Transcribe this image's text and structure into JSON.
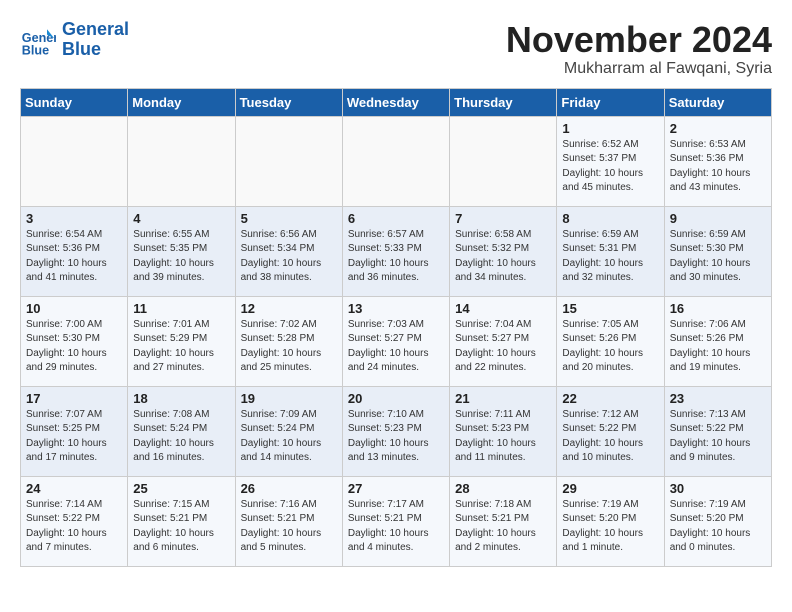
{
  "header": {
    "logo_line1": "General",
    "logo_line2": "Blue",
    "title": "November 2024",
    "subtitle": "Mukharram al Fawqani, Syria"
  },
  "weekdays": [
    "Sunday",
    "Monday",
    "Tuesday",
    "Wednesday",
    "Thursday",
    "Friday",
    "Saturday"
  ],
  "weeks": [
    [
      {
        "day": "",
        "info": ""
      },
      {
        "day": "",
        "info": ""
      },
      {
        "day": "",
        "info": ""
      },
      {
        "day": "",
        "info": ""
      },
      {
        "day": "",
        "info": ""
      },
      {
        "day": "1",
        "info": "Sunrise: 6:52 AM\nSunset: 5:37 PM\nDaylight: 10 hours\nand 45 minutes."
      },
      {
        "day": "2",
        "info": "Sunrise: 6:53 AM\nSunset: 5:36 PM\nDaylight: 10 hours\nand 43 minutes."
      }
    ],
    [
      {
        "day": "3",
        "info": "Sunrise: 6:54 AM\nSunset: 5:36 PM\nDaylight: 10 hours\nand 41 minutes."
      },
      {
        "day": "4",
        "info": "Sunrise: 6:55 AM\nSunset: 5:35 PM\nDaylight: 10 hours\nand 39 minutes."
      },
      {
        "day": "5",
        "info": "Sunrise: 6:56 AM\nSunset: 5:34 PM\nDaylight: 10 hours\nand 38 minutes."
      },
      {
        "day": "6",
        "info": "Sunrise: 6:57 AM\nSunset: 5:33 PM\nDaylight: 10 hours\nand 36 minutes."
      },
      {
        "day": "7",
        "info": "Sunrise: 6:58 AM\nSunset: 5:32 PM\nDaylight: 10 hours\nand 34 minutes."
      },
      {
        "day": "8",
        "info": "Sunrise: 6:59 AM\nSunset: 5:31 PM\nDaylight: 10 hours\nand 32 minutes."
      },
      {
        "day": "9",
        "info": "Sunrise: 6:59 AM\nSunset: 5:30 PM\nDaylight: 10 hours\nand 30 minutes."
      }
    ],
    [
      {
        "day": "10",
        "info": "Sunrise: 7:00 AM\nSunset: 5:30 PM\nDaylight: 10 hours\nand 29 minutes."
      },
      {
        "day": "11",
        "info": "Sunrise: 7:01 AM\nSunset: 5:29 PM\nDaylight: 10 hours\nand 27 minutes."
      },
      {
        "day": "12",
        "info": "Sunrise: 7:02 AM\nSunset: 5:28 PM\nDaylight: 10 hours\nand 25 minutes."
      },
      {
        "day": "13",
        "info": "Sunrise: 7:03 AM\nSunset: 5:27 PM\nDaylight: 10 hours\nand 24 minutes."
      },
      {
        "day": "14",
        "info": "Sunrise: 7:04 AM\nSunset: 5:27 PM\nDaylight: 10 hours\nand 22 minutes."
      },
      {
        "day": "15",
        "info": "Sunrise: 7:05 AM\nSunset: 5:26 PM\nDaylight: 10 hours\nand 20 minutes."
      },
      {
        "day": "16",
        "info": "Sunrise: 7:06 AM\nSunset: 5:26 PM\nDaylight: 10 hours\nand 19 minutes."
      }
    ],
    [
      {
        "day": "17",
        "info": "Sunrise: 7:07 AM\nSunset: 5:25 PM\nDaylight: 10 hours\nand 17 minutes."
      },
      {
        "day": "18",
        "info": "Sunrise: 7:08 AM\nSunset: 5:24 PM\nDaylight: 10 hours\nand 16 minutes."
      },
      {
        "day": "19",
        "info": "Sunrise: 7:09 AM\nSunset: 5:24 PM\nDaylight: 10 hours\nand 14 minutes."
      },
      {
        "day": "20",
        "info": "Sunrise: 7:10 AM\nSunset: 5:23 PM\nDaylight: 10 hours\nand 13 minutes."
      },
      {
        "day": "21",
        "info": "Sunrise: 7:11 AM\nSunset: 5:23 PM\nDaylight: 10 hours\nand 11 minutes."
      },
      {
        "day": "22",
        "info": "Sunrise: 7:12 AM\nSunset: 5:22 PM\nDaylight: 10 hours\nand 10 minutes."
      },
      {
        "day": "23",
        "info": "Sunrise: 7:13 AM\nSunset: 5:22 PM\nDaylight: 10 hours\nand 9 minutes."
      }
    ],
    [
      {
        "day": "24",
        "info": "Sunrise: 7:14 AM\nSunset: 5:22 PM\nDaylight: 10 hours\nand 7 minutes."
      },
      {
        "day": "25",
        "info": "Sunrise: 7:15 AM\nSunset: 5:21 PM\nDaylight: 10 hours\nand 6 minutes."
      },
      {
        "day": "26",
        "info": "Sunrise: 7:16 AM\nSunset: 5:21 PM\nDaylight: 10 hours\nand 5 minutes."
      },
      {
        "day": "27",
        "info": "Sunrise: 7:17 AM\nSunset: 5:21 PM\nDaylight: 10 hours\nand 4 minutes."
      },
      {
        "day": "28",
        "info": "Sunrise: 7:18 AM\nSunset: 5:21 PM\nDaylight: 10 hours\nand 2 minutes."
      },
      {
        "day": "29",
        "info": "Sunrise: 7:19 AM\nSunset: 5:20 PM\nDaylight: 10 hours\nand 1 minute."
      },
      {
        "day": "30",
        "info": "Sunrise: 7:19 AM\nSunset: 5:20 PM\nDaylight: 10 hours\nand 0 minutes."
      }
    ]
  ]
}
